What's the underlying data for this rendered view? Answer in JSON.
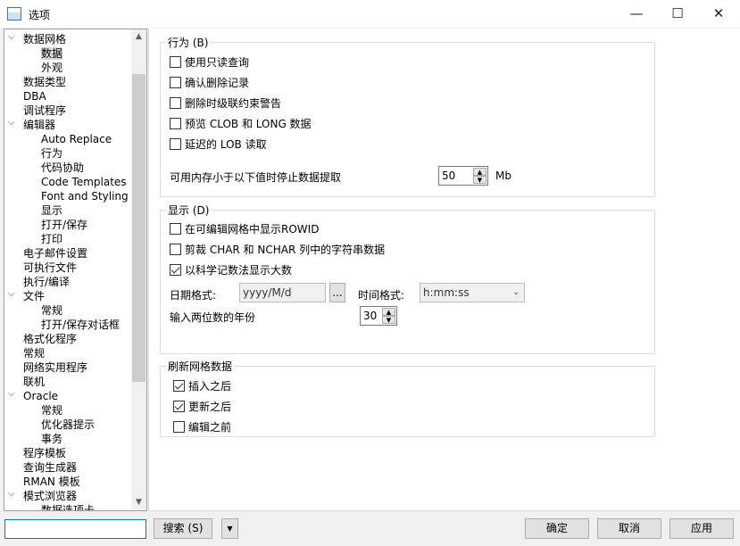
{
  "window": {
    "title": "选项",
    "icon": "options-app-icon"
  },
  "tree": {
    "items": [
      {
        "label": "数据网格",
        "level": 0,
        "expanded": true
      },
      {
        "label": "数据",
        "level": 1,
        "selected": true
      },
      {
        "label": "外观",
        "level": 1
      },
      {
        "label": "数据类型",
        "level": 0
      },
      {
        "label": "DBA",
        "level": 0
      },
      {
        "label": "调试程序",
        "level": 0
      },
      {
        "label": "编辑器",
        "level": 0,
        "expanded": true
      },
      {
        "label": "Auto Replace",
        "level": 1
      },
      {
        "label": "行为",
        "level": 1
      },
      {
        "label": "代码协助",
        "level": 1
      },
      {
        "label": "Code Templates",
        "level": 1
      },
      {
        "label": "Font and Styling",
        "level": 1
      },
      {
        "label": "显示",
        "level": 1
      },
      {
        "label": "打开/保存",
        "level": 1
      },
      {
        "label": "打印",
        "level": 1
      },
      {
        "label": "电子邮件设置",
        "level": 0
      },
      {
        "label": "可执行文件",
        "level": 0
      },
      {
        "label": "执行/编译",
        "level": 0
      },
      {
        "label": "文件",
        "level": 0,
        "expanded": true
      },
      {
        "label": "常规",
        "level": 1
      },
      {
        "label": "打开/保存对话框",
        "level": 1
      },
      {
        "label": "格式化程序",
        "level": 0
      },
      {
        "label": "常规",
        "level": 0
      },
      {
        "label": "网络实用程序",
        "level": 0
      },
      {
        "label": "联机",
        "level": 0
      },
      {
        "label": "Oracle",
        "level": 0,
        "expanded": true
      },
      {
        "label": "常规",
        "level": 1
      },
      {
        "label": "优化器提示",
        "level": 1
      },
      {
        "label": "事务",
        "level": 1
      },
      {
        "label": "程序模板",
        "level": 0
      },
      {
        "label": "查询生成器",
        "level": 0
      },
      {
        "label": "RMAN 模板",
        "level": 0
      },
      {
        "label": "模式浏览器",
        "level": 0,
        "expanded": true
      },
      {
        "label": "数据选项卡",
        "level": 1
      }
    ]
  },
  "behavior": {
    "title": "行为 (B)",
    "options": [
      {
        "label": "使用只读查询",
        "checked": false
      },
      {
        "label": "确认删除记录",
        "checked": false
      },
      {
        "label": "删除时级联约束警告",
        "checked": false
      },
      {
        "label": "预览 CLOB 和 LONG 数据",
        "checked": false
      },
      {
        "label": "延迟的 LOB 读取",
        "checked": false
      }
    ],
    "memory_label": "可用内存小于以下值时停止数据提取",
    "memory_value": "50",
    "memory_unit": "Mb"
  },
  "display": {
    "title": "显示 (D)",
    "options": [
      {
        "label": "在可编辑网格中显示ROWID",
        "checked": false
      },
      {
        "label": "剪裁 CHAR 和 NCHAR 列中的字符串数据",
        "checked": false
      },
      {
        "label": "以科学记数法显示大数",
        "checked": true
      }
    ],
    "date_label": "日期格式:",
    "date_value": "yyyy/M/d",
    "browse_label": "...",
    "time_label": "时间格式:",
    "time_value": "h:mm:ss",
    "year_label": "输入两位数的年份",
    "year_value": "30"
  },
  "refresh": {
    "title": "刷新网格数据",
    "options": [
      {
        "label": "插入之后",
        "checked": true
      },
      {
        "label": "更新之后",
        "checked": true
      },
      {
        "label": "编辑之前",
        "checked": false
      }
    ]
  },
  "footer": {
    "search_value": "",
    "search_label": "搜索 (S)",
    "ok": "确定",
    "cancel": "取消",
    "apply": "应用"
  }
}
